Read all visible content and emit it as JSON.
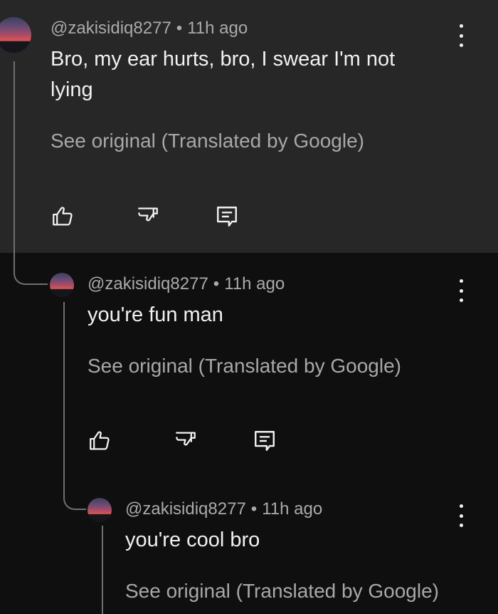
{
  "comments": [
    {
      "author": "@zakisidiq8277",
      "separator": "•",
      "time": "11h ago",
      "text_lines": [
        "Bro, my ear hurts, bro, I swear I'm not",
        "lying"
      ],
      "see_original": "See original (Translated by Google)",
      "highlighted": true,
      "icons": [
        "like-icon",
        "dislike-icon",
        "reply-icon",
        "more-options-icon"
      ]
    },
    {
      "author": "@zakisidiq8277",
      "separator": "•",
      "time": "11h ago",
      "text_lines": [
        "you're fun man"
      ],
      "see_original": "See original (Translated by Google)",
      "highlighted": false,
      "icons": [
        "like-icon",
        "dislike-icon",
        "reply-icon",
        "more-options-icon"
      ]
    },
    {
      "author": "@zakisidiq8277",
      "separator": "•",
      "time": "11h ago",
      "text_lines": [
        "you're cool bro"
      ],
      "see_original": "See original (Translated by Google)",
      "highlighted": false,
      "icons": [
        "more-options-icon"
      ]
    }
  ],
  "colors": {
    "highlight_background": "#272727",
    "page_background": "#0f0f0f",
    "primary_text": "#f1f1f1",
    "secondary_text": "#aaaaaa",
    "thread_line": "#6f6f6f"
  }
}
